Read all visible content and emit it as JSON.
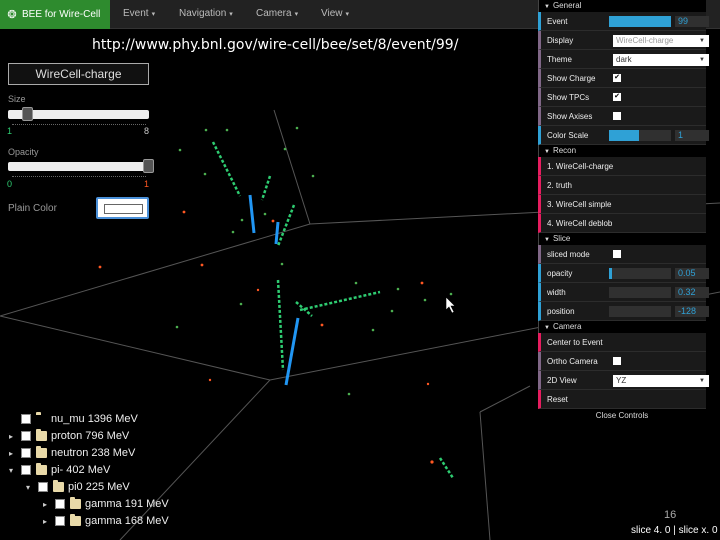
{
  "navbar": {
    "brand": "BEE for Wire-Cell",
    "menus": [
      "Event",
      "Navigation",
      "Camera",
      "View"
    ]
  },
  "url": "http://www.phy.bnl.gov/wire-cell/bee/set/8/event/99/",
  "left_panel": {
    "detector_label": "WireCell-charge",
    "size": {
      "label": "Size",
      "min": "1",
      "max": "8",
      "value": 2
    },
    "opacity": {
      "label": "Opacity",
      "min": "0",
      "max": "1",
      "value": 1
    },
    "plain_color_label": "Plain Color"
  },
  "tree": [
    {
      "label": "nu_mu 1396 MeV",
      "indent": 0,
      "arrow": "",
      "folder": false
    },
    {
      "label": "proton 796 MeV",
      "indent": 0,
      "arrow": "▸",
      "folder": true
    },
    {
      "label": "neutron 238 MeV",
      "indent": 0,
      "arrow": "▸",
      "folder": true
    },
    {
      "label": "pi- 402 MeV",
      "indent": 0,
      "arrow": "▾",
      "folder": true
    },
    {
      "label": "pi0 225 MeV",
      "indent": 1,
      "arrow": "▾",
      "folder": true
    },
    {
      "label": "gamma 191 MeV",
      "indent": 2,
      "arrow": "▸",
      "folder": true
    },
    {
      "label": "gamma 168 MeV",
      "indent": 2,
      "arrow": "▸",
      "folder": true
    }
  ],
  "gui": {
    "general": {
      "title": "General",
      "event_label": "Event",
      "event_value": "99",
      "display_label": "Display",
      "display_value": "WireCell-charge",
      "theme_label": "Theme",
      "theme_value": "dark",
      "show_charge_label": "Show Charge",
      "show_tpcs_label": "Show TPCs",
      "show_axises_label": "Show Axises",
      "color_scale_label": "Color Scale",
      "color_scale_value": "1"
    },
    "recon": {
      "title": "Recon",
      "items": [
        "1. WireCell-charge",
        "2. truth",
        "3. WireCell simple",
        "4. WireCell deblob"
      ]
    },
    "slice": {
      "title": "Slice",
      "sliced_mode_label": "sliced mode",
      "opacity_label": "opacity",
      "opacity_value": "0.05",
      "width_label": "width",
      "width_value": "0.32",
      "position_label": "position",
      "position_value": "-128"
    },
    "camera": {
      "title": "Camera",
      "center_label": "Center to Event",
      "ortho_label": "Ortho Camera",
      "view_label": "2D View",
      "view_value": "YZ",
      "reset_label": "Reset"
    },
    "close_label": "Close Controls"
  },
  "page_number": "16",
  "slice_info": "slice 4. 0 | slice x. 0",
  "colors": {
    "accent": "#2fa1d6",
    "brand": "#2e8b2e"
  }
}
